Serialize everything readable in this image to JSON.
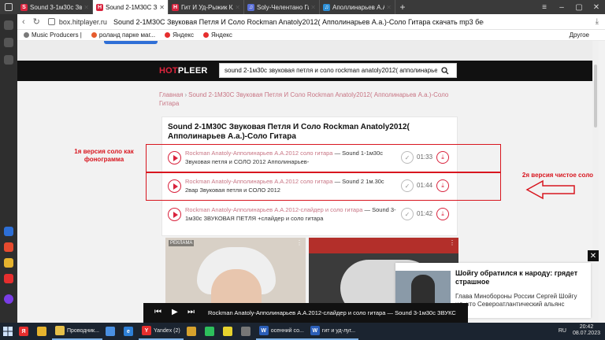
{
  "browser": {
    "tabs": [
      {
        "label": "Sound 3-1м30с Звукова",
        "fav": "S",
        "color": "#d9233d",
        "active": false
      },
      {
        "label": "Sound 2-1М30С Звукова",
        "fav": "H",
        "color": "#d9233d",
        "active": true
      },
      {
        "label": "Гит И Уд-Рыжик Классно",
        "fav": "H",
        "color": "#d9233d",
        "active": false
      },
      {
        "label": "Soly-Челентано Гит И Уд",
        "fav": "♫",
        "color": "#5b6fd6",
        "active": false
      },
      {
        "label": "Аполлинарьев А.А.1990г",
        "fav": "♫",
        "color": "#2d8fd6",
        "active": false
      }
    ],
    "new_tab": "+",
    "host": "box.hitplayer.ru",
    "page_title": "Sound 2-1М30С Звуковая Петля И Соло Rockman Anatoly2012( Апполинарьев А.а.)-Соло Гитара скачать mp3 бесплатно и слу...",
    "bookmarks": [
      {
        "label": "Music Producers |",
        "color": "#7a7a7a"
      },
      {
        "label": "роланд парке маг...",
        "color": "#e65c2e"
      },
      {
        "label": "Яндекс",
        "color": "#e62e2e"
      },
      {
        "label": "Яндекс",
        "color": "#e62e2e"
      }
    ],
    "other_bookmarks": "Другое"
  },
  "site": {
    "logo_hot": "HOT",
    "logo_rest": "PLEER",
    "search_value": "sound 2-1м30с звуковая петля и соло rockman anatoly2012( апполинарьев а",
    "breadcrumb_home": "Главная",
    "breadcrumb_current": "Sound 2-1М30С Звуковая Петля И Соло Rockman Anatoly2012( Апполинарьев А.а.)-Соло Гитара",
    "heading": "Sound 2-1М30С Звуковая Петля И Соло Rockman Anatoly2012( Апполинарьев А.а.)-Соло Гитара"
  },
  "tracks": [
    {
      "artist": "Rockman Anatoly-Апполинарьев А.А.2012 соло гитара",
      "title": "Sound 1-1м30с Звуковая петля и СОЛО 2012 Апполинарьев-",
      "duration": "01:33"
    },
    {
      "artist": "Rockman Anatoly-Апполинарьев А.А.2012 соло гитара",
      "title": "Sound 2 1м.30с 2вар Звуковая петля и СОЛО 2012",
      "duration": "01:44"
    },
    {
      "artist": "Rockman Anatoly-Апполинарьев А.А.2012-слайдер и соло гитара",
      "title": "Sound 3-1м30с ЗВУКОВАЯ ПЕТЛЯ +слайдер и соло гитара",
      "duration": "01:42"
    }
  ],
  "annotations": {
    "left_text": "1я версия соло как фонограмма",
    "right_text": "2я версия чистое соло",
    "color": "#d8161f"
  },
  "ads": {
    "label": "РЕКЛАМА"
  },
  "news": {
    "title": "Шойгу обратился к народу: грядет страшное",
    "desc": "Глава Минобороны России Сергей Шойгу",
    "desc2": "ил, что Североатлантический альянс"
  },
  "player": {
    "now_playing": "Rockman Anatoly-Апполинарьев А.А.2012-слайдер и соло гитара — Sound 3-1м30с ЗВУКС"
  },
  "taskbar": {
    "items": [
      {
        "label": "",
        "ic": "Я",
        "color": "#e62e2e"
      },
      {
        "label": "",
        "ic": "",
        "color": "#e6b32e"
      },
      {
        "label": "Проводник...",
        "ic": "",
        "color": "#e6c04a"
      },
      {
        "label": "",
        "ic": "",
        "color": "#4a90e2"
      },
      {
        "label": "",
        "ic": "e",
        "color": "#2d7fd6"
      },
      {
        "label": "Yandex (2)",
        "ic": "Y",
        "color": "#e62e2e"
      },
      {
        "label": "",
        "ic": "",
        "color": "#d6a22d"
      },
      {
        "label": "",
        "ic": "",
        "color": "#2dbf5c"
      },
      {
        "label": "",
        "ic": "",
        "color": "#e6d22e"
      },
      {
        "label": "",
        "ic": "",
        "color": "#777777"
      },
      {
        "label": "осенний со...",
        "ic": "W",
        "color": "#2b5eb8"
      },
      {
        "label": "гит и уд-луг...",
        "ic": "W",
        "color": "#2b5eb8"
      }
    ],
    "lang": "RU",
    "time": "20:42",
    "date": "08.07.2023"
  }
}
